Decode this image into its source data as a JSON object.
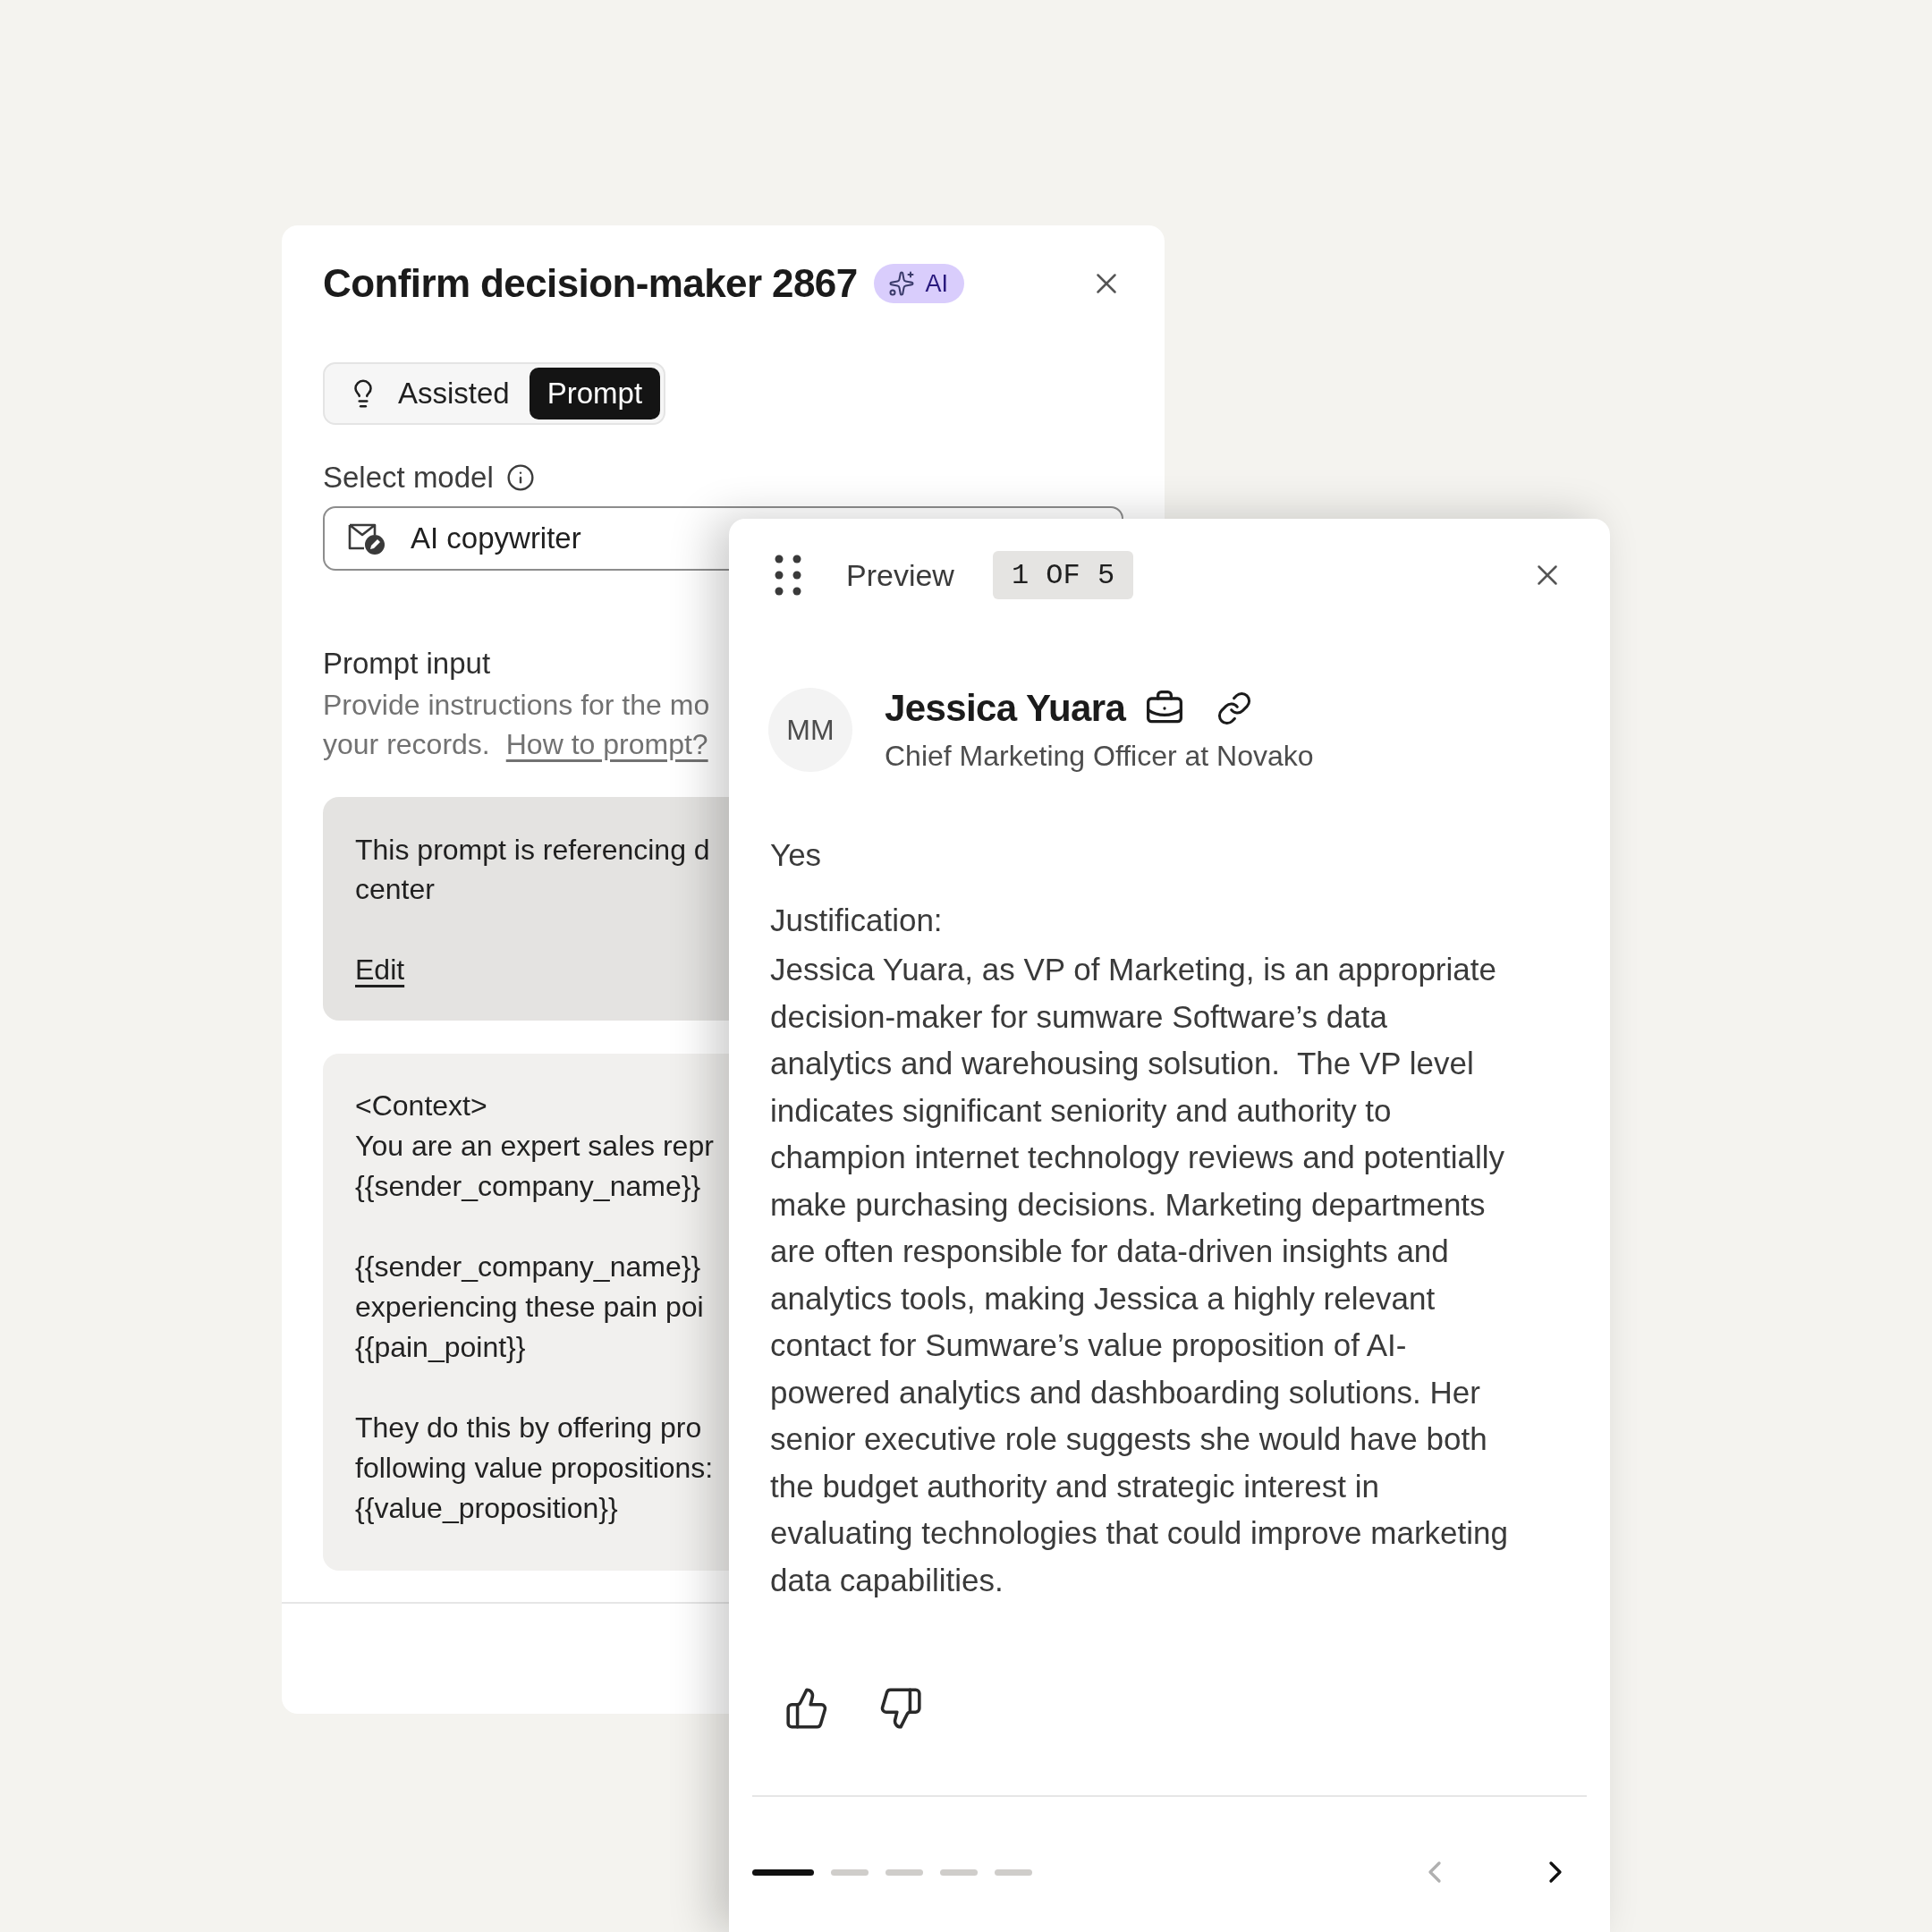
{
  "editor_panel": {
    "title": "Confirm decision-maker 2867",
    "badge": "AI",
    "mode_tabs": [
      {
        "label": "Assisted",
        "selected": false
      },
      {
        "label": "Prompt",
        "selected": true
      }
    ],
    "model_label": "Select model",
    "model_select": {
      "value": "AI copywriter"
    },
    "prompt_label": "Prompt input",
    "prompt_help": "Provide instructions for the mo\nyour records.",
    "prompt_help_link": "How to prompt?",
    "notice": {
      "text": "This prompt is referencing d\ncenter",
      "link": "Edit"
    },
    "prompt_text": "<Context>\nYou are an expert sales repr\n{{sender_company_name}}\n\n{{sender_company_name}}\nexperiencing these pain poi\n{{pain_point}}\n\nThey do this by offering pro\nfollowing value propositions:\n{{value_proposition}}"
  },
  "preview_panel": {
    "title": "Preview",
    "counter": "1 OF 5",
    "contact": {
      "initials": "MM",
      "name": "Jessica Yuara",
      "subtitle": "Chief Marketing Officer at Novako"
    },
    "answer": "Yes",
    "justification_label": "Justification:",
    "justification": "Jessica Yuara, as VP of Marketing, is an appropriate\ndecision-maker for sumware Software’s data\nanalytics and warehousing solsution.  The VP level\nindicates significant seniority and authority to\nchampion internet technology reviews and potentially\nmake purchasing decisions. Marketing departments\nare often responsible for data-driven insights and\nanalytics tools, making Jessica a highly relevant\ncontact for Sumware’s value proposition of AI-\npowered analytics and dashboarding solutions. Her\nsenior executive role suggests she would have both\nthe budget authority and strategic interest in\nevaluating technologies that could improve marketing\ndata capabilities.",
    "pagination": {
      "pages": [
        {
          "selected": true
        },
        {
          "selected": false
        },
        {
          "selected": false
        },
        {
          "selected": false
        },
        {
          "selected": false
        }
      ],
      "previous": {
        "disabled": true
      },
      "next": {
        "disabled": false
      }
    }
  }
}
